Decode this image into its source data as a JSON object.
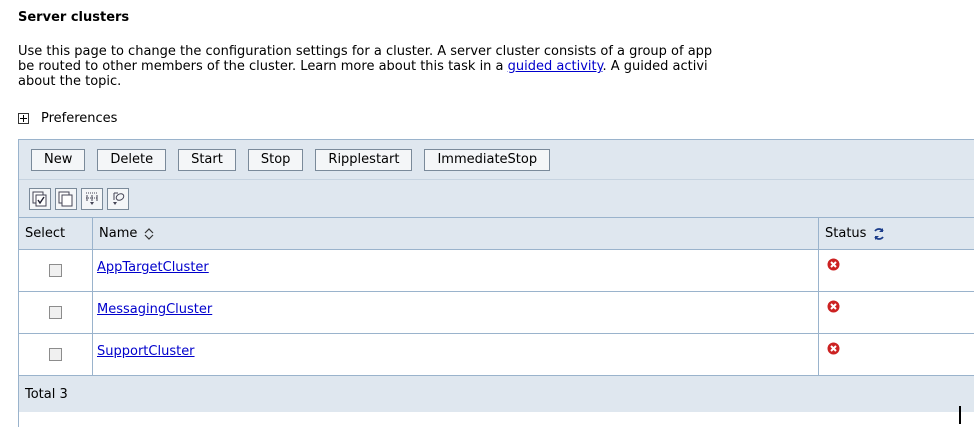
{
  "page": {
    "title": "Server clusters",
    "description_line1": "Use this page to change the configuration settings for a cluster. A server cluster consists of a group of app",
    "description_line2_before": "be routed to other members of the cluster. Learn more about this task in a ",
    "description_link": "guided activity",
    "description_line2_after": ". A guided activi",
    "description_line3": "about the topic."
  },
  "preferences": {
    "label": "Preferences",
    "icon": "expand-plus-icon"
  },
  "toolbar": {
    "buttons": [
      "New",
      "Delete",
      "Start",
      "Stop",
      "Ripplestart",
      "ImmediateStop"
    ],
    "icons": [
      "select-all-icon",
      "deselect-all-icon",
      "show-filter-icon",
      "clear-filter-icon"
    ]
  },
  "table": {
    "columns": {
      "select": "Select",
      "name": "Name",
      "status": "Status"
    },
    "rows": [
      {
        "name": "AppTargetCluster",
        "status": "stopped"
      },
      {
        "name": "MessagingCluster",
        "status": "stopped"
      },
      {
        "name": "SupportCluster",
        "status": "stopped"
      }
    ],
    "total": "Total 3"
  },
  "colors": {
    "header_bg": "#dfe7ef",
    "border": "#9ab3cc",
    "link": "#0000cc",
    "status_stopped": "#cc2222"
  }
}
